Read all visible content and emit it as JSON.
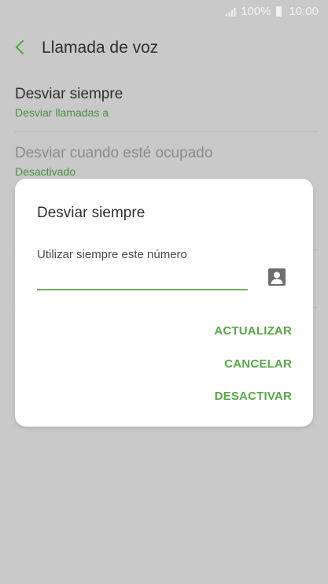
{
  "status_bar": {
    "battery_text": "100%",
    "time": "10:00",
    "icons": [
      "signal-icon",
      "battery-icon"
    ]
  },
  "header": {
    "back_icon": "chevron-left-icon",
    "title": "Llamada de voz"
  },
  "list": {
    "items": [
      {
        "title": "Desviar siempre",
        "subtitle": "Desviar llamadas a"
      },
      {
        "title": "Desviar cuando esté ocupado",
        "subtitle": "Desactivado"
      }
    ]
  },
  "dialog": {
    "title": "Desviar siempre",
    "field_label": "Utilizar siempre este número",
    "field_value": "",
    "contact_icon": "contact-icon",
    "actions": [
      "ACTUALIZAR",
      "CANCELAR",
      "DESACTIVAR"
    ]
  },
  "colors": {
    "accent": "#5aa84b",
    "scrim_background": "#c9c9c9",
    "dialog_background": "#ffffff"
  }
}
